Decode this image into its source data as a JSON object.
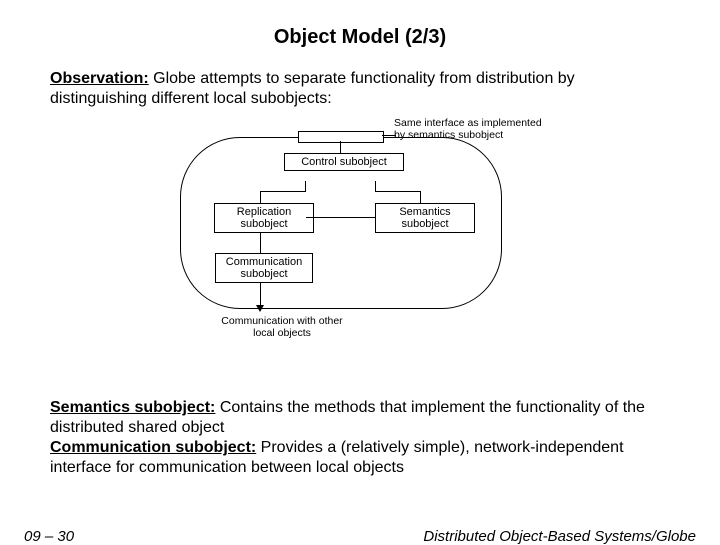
{
  "title": "Object Model (2/3)",
  "observation": {
    "label": "Observation:",
    "text": " Globe attempts to separate functionality from distribution by distinguishing different local subobjects:"
  },
  "diagram": {
    "annot_top": "Same interface as implemented by semantics subobject",
    "control": "Control subobject",
    "replication": "Replication subobject",
    "semantics": "Semantics subobject",
    "communication": "Communication subobject",
    "annot_bottom": "Communication with other local objects"
  },
  "defs": {
    "sem_label": "Semantics subobject:",
    "sem_text": " Contains the methods that implement the functionality of the distributed shared object",
    "comm_label": "Communication subobject:",
    "comm_text": " Provides a (relatively simple), network-independent interface for communication between local objects"
  },
  "footer": {
    "left": "09 – 30",
    "right": "Distributed Object-Based Systems/Globe"
  }
}
